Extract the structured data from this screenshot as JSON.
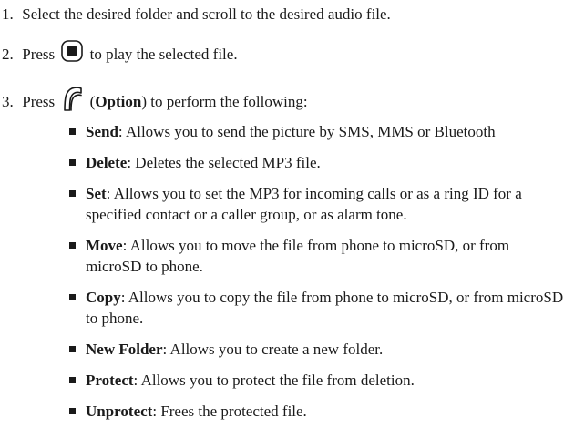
{
  "steps": [
    {
      "number": "1.",
      "text": "Select the desired folder and scroll to the desired audio file."
    },
    {
      "number": "2.",
      "before": "Press",
      "icon": "center-key-icon",
      "after": "to play the selected file."
    },
    {
      "number": "3.",
      "before": "Press",
      "icon": "option-softkey-icon",
      "open_paren": "(",
      "bold": "Option",
      "after": ") to perform the following:"
    }
  ],
  "options": [
    {
      "term": "Send",
      "desc": ": Allows you to send the picture by SMS, MMS or Bluetooth"
    },
    {
      "term": "Delete",
      "desc": ": Deletes the selected MP3 file."
    },
    {
      "term": "Set",
      "desc": ": Allows you to set the MP3 for incoming calls or as a ring ID for a specified contact or a caller group, or as alarm tone."
    },
    {
      "term": "Move",
      "desc": ": Allows you to move the file from phone to microSD, or from microSD to phone."
    },
    {
      "term": "Copy",
      "desc": ": Allows you to copy the file from phone to microSD, or from microSD to phone."
    },
    {
      "term": "New Folder",
      "desc": ": Allows you to create a new folder."
    },
    {
      "term": "Protect",
      "desc": ": Allows you to protect the file from deletion."
    },
    {
      "term": "Unprotect",
      "desc": ": Frees the protected file."
    }
  ]
}
